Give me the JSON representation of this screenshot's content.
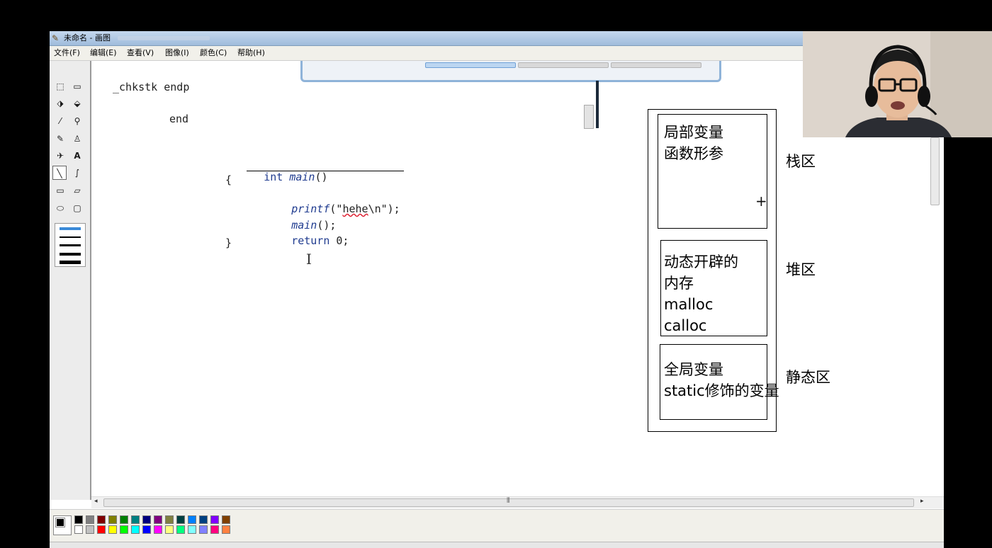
{
  "window": {
    "title": "未命名 - 画图",
    "app_icon": "paint-icon"
  },
  "menu": {
    "items": [
      "文件(F)",
      "编辑(E)",
      "查看(V)",
      "图像(I)",
      "颜色(C)",
      "帮助(H)"
    ]
  },
  "toolbox": {
    "tools": [
      {
        "name": "free-select-icon",
        "glyph": "⬚"
      },
      {
        "name": "rect-select-icon",
        "glyph": "⬜"
      },
      {
        "name": "eraser-icon",
        "glyph": "◈"
      },
      {
        "name": "fill-bucket-icon",
        "glyph": "⬙"
      },
      {
        "name": "color-picker-icon",
        "glyph": "⁄"
      },
      {
        "name": "magnifier-icon",
        "glyph": "🔍"
      },
      {
        "name": "pencil-icon",
        "glyph": "✎"
      },
      {
        "name": "brush-icon",
        "glyph": "♙"
      },
      {
        "name": "airbrush-icon",
        "glyph": "✈"
      },
      {
        "name": "text-tool-icon",
        "glyph": "A"
      },
      {
        "name": "line-tool-icon",
        "glyph": "╲"
      },
      {
        "name": "curve-tool-icon",
        "glyph": "∫"
      },
      {
        "name": "rectangle-tool-icon",
        "glyph": "▭"
      },
      {
        "name": "polygon-tool-icon",
        "glyph": "▱"
      },
      {
        "name": "ellipse-tool-icon",
        "glyph": "⬭"
      },
      {
        "name": "rounded-rect-tool-icon",
        "glyph": "▢"
      }
    ],
    "active_tool": "line-tool-icon"
  },
  "code": {
    "asm_line1": "_chkstk endp",
    "asm_line2": "end",
    "kw_int": "int",
    "fn_main": "main",
    "parens": "()",
    "open_brace": "{",
    "printf_fn": "printf",
    "printf_open": "(\"",
    "printf_word": "hehe",
    "printf_rest": "\\n\");",
    "main_call_fn": "main",
    "main_call_rest": "();",
    "return_kw": "return",
    "return_rest": " 0;",
    "close_brace": "}"
  },
  "diagram": {
    "stack_content": "局部变量\n函数形参",
    "stack_label": "栈区",
    "heap_content": "动态开辟的\n内存\nmalloc\ncalloc",
    "heap_label": "堆区",
    "static_content": "全局变量\nstatic修饰的变量",
    "static_label": "静态区"
  },
  "palette": {
    "top_row": [
      "#000000",
      "#808080",
      "#800000",
      "#808000",
      "#008000",
      "#008080",
      "#000080",
      "#800080",
      "#808040",
      "#004040",
      "#0080ff",
      "#004080",
      "#8000ff",
      "#804000"
    ],
    "bottom_row": [
      "#ffffff",
      "#c0c0c0",
      "#ff0000",
      "#ffff00",
      "#00ff00",
      "#00ffff",
      "#0000ff",
      "#ff00ff",
      "#ffff80",
      "#00ff80",
      "#80ffff",
      "#8080ff",
      "#ff0080",
      "#ff8040"
    ],
    "foreground": "#000000",
    "background": "#ffffff"
  },
  "scrollbar": {
    "grip": "⦀"
  }
}
